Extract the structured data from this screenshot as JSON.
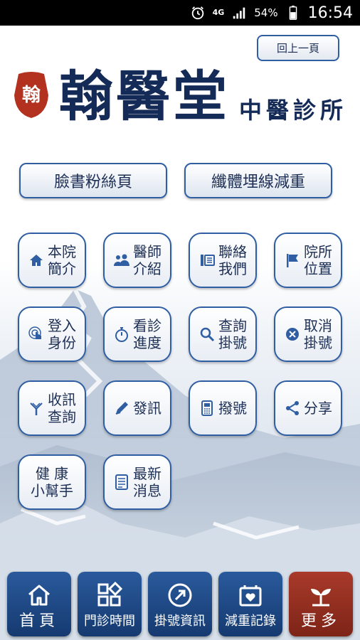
{
  "status_bar": {
    "network": "4G",
    "battery": "54%",
    "time": "16:54"
  },
  "header": {
    "back_label": "回上一頁",
    "seal_text": "翰",
    "logo_title": "翰醫堂",
    "logo_subtitle": "中醫診所"
  },
  "links": [
    {
      "label": "臉書粉絲頁"
    },
    {
      "label": "纖體埋線減重"
    }
  ],
  "menu": [
    {
      "label": "本院\n簡介",
      "icon": "home-icon"
    },
    {
      "label": "醫師\n介紹",
      "icon": "doctors-icon"
    },
    {
      "label": "聯絡\n我們",
      "icon": "contact-icon"
    },
    {
      "label": "院所\n位置",
      "icon": "flag-icon"
    },
    {
      "label": "登入\n身份",
      "icon": "login-icon"
    },
    {
      "label": "看診\n進度",
      "icon": "stopwatch-icon"
    },
    {
      "label": "查詢\n掛號",
      "icon": "search-icon"
    },
    {
      "label": "取消\n掛號",
      "icon": "cancel-icon"
    },
    {
      "label": "收訊\n查詢",
      "icon": "antenna-icon"
    },
    {
      "label": "發訊",
      "icon": "pencil-icon"
    },
    {
      "label": "撥號",
      "icon": "phone-icon"
    },
    {
      "label": "分享",
      "icon": "share-icon"
    },
    {
      "label": "健 康\n小幫手",
      "icon": ""
    },
    {
      "label": "最新\n消息",
      "icon": "news-icon"
    }
  ],
  "bottom_nav": [
    {
      "label": "首頁",
      "icon": "home-icon"
    },
    {
      "label": "門診時間",
      "icon": "schedule-icon"
    },
    {
      "label": "掛號資訊",
      "icon": "registration-icon"
    },
    {
      "label": "減重記錄",
      "icon": "weight-record-icon"
    },
    {
      "label": "更多",
      "icon": "sprout-icon"
    }
  ],
  "colors": {
    "border_blue": "#2f5ea3",
    "text_navy": "#1d2f55",
    "logo_navy": "#142a57",
    "nav_blue": "#1f4a86",
    "nav_red": "#9a3222",
    "seal_red": "#b2321f"
  }
}
